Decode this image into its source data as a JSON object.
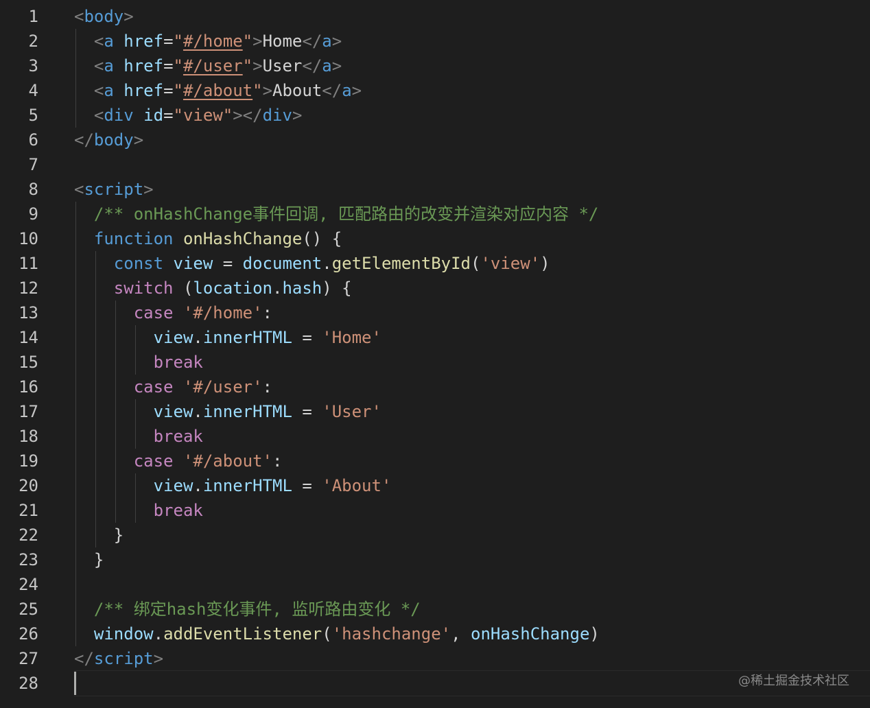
{
  "editor": {
    "lines": [
      {
        "n": "1",
        "tokens": [
          [
            "punc",
            "<"
          ],
          [
            "tag",
            "body"
          ],
          [
            "punc",
            ">"
          ]
        ]
      },
      {
        "n": "2",
        "tokens": [
          [
            "def",
            "  "
          ],
          [
            "punc",
            "<"
          ],
          [
            "tag",
            "a"
          ],
          [
            "def",
            " "
          ],
          [
            "attr",
            "href"
          ],
          [
            "op",
            "="
          ],
          [
            "str",
            "\""
          ],
          [
            "link",
            "#/home"
          ],
          [
            "str",
            "\""
          ],
          [
            "punc",
            ">"
          ],
          [
            "text",
            "Home"
          ],
          [
            "punc",
            "</"
          ],
          [
            "tag",
            "a"
          ],
          [
            "punc",
            ">"
          ]
        ]
      },
      {
        "n": "3",
        "tokens": [
          [
            "def",
            "  "
          ],
          [
            "punc",
            "<"
          ],
          [
            "tag",
            "a"
          ],
          [
            "def",
            " "
          ],
          [
            "attr",
            "href"
          ],
          [
            "op",
            "="
          ],
          [
            "str",
            "\""
          ],
          [
            "link",
            "#/user"
          ],
          [
            "str",
            "\""
          ],
          [
            "punc",
            ">"
          ],
          [
            "text",
            "User"
          ],
          [
            "punc",
            "</"
          ],
          [
            "tag",
            "a"
          ],
          [
            "punc",
            ">"
          ]
        ]
      },
      {
        "n": "4",
        "tokens": [
          [
            "def",
            "  "
          ],
          [
            "punc",
            "<"
          ],
          [
            "tag",
            "a"
          ],
          [
            "def",
            " "
          ],
          [
            "attr",
            "href"
          ],
          [
            "op",
            "="
          ],
          [
            "str",
            "\""
          ],
          [
            "link",
            "#/about"
          ],
          [
            "str",
            "\""
          ],
          [
            "punc",
            ">"
          ],
          [
            "text",
            "About"
          ],
          [
            "punc",
            "</"
          ],
          [
            "tag",
            "a"
          ],
          [
            "punc",
            ">"
          ]
        ]
      },
      {
        "n": "5",
        "tokens": [
          [
            "def",
            "  "
          ],
          [
            "punc",
            "<"
          ],
          [
            "tag",
            "div"
          ],
          [
            "def",
            " "
          ],
          [
            "attr",
            "id"
          ],
          [
            "op",
            "="
          ],
          [
            "str",
            "\"view\""
          ],
          [
            "punc",
            "></"
          ],
          [
            "tag",
            "div"
          ],
          [
            "punc",
            ">"
          ]
        ]
      },
      {
        "n": "6",
        "tokens": [
          [
            "punc",
            "</"
          ],
          [
            "tag",
            "body"
          ],
          [
            "punc",
            ">"
          ]
        ]
      },
      {
        "n": "7",
        "tokens": []
      },
      {
        "n": "8",
        "tokens": [
          [
            "punc",
            "<"
          ],
          [
            "tag",
            "script"
          ],
          [
            "punc",
            ">"
          ]
        ]
      },
      {
        "n": "9",
        "tokens": [
          [
            "def",
            "  "
          ],
          [
            "comment",
            "/** onHashChange事件回调, 匹配路由的改变并渲染对应内容 */"
          ]
        ]
      },
      {
        "n": "10",
        "tokens": [
          [
            "def",
            "  "
          ],
          [
            "kw",
            "function"
          ],
          [
            "def",
            " "
          ],
          [
            "fn",
            "onHashChange"
          ],
          [
            "def",
            "() {"
          ]
        ]
      },
      {
        "n": "11",
        "tokens": [
          [
            "def",
            "    "
          ],
          [
            "kw",
            "const"
          ],
          [
            "def",
            " "
          ],
          [
            "var",
            "view"
          ],
          [
            "def",
            " = "
          ],
          [
            "var",
            "document"
          ],
          [
            "def",
            "."
          ],
          [
            "fn",
            "getElementById"
          ],
          [
            "def",
            "("
          ],
          [
            "str",
            "'view'"
          ],
          [
            "def",
            ")"
          ]
        ]
      },
      {
        "n": "12",
        "tokens": [
          [
            "def",
            "    "
          ],
          [
            "ctrl",
            "switch"
          ],
          [
            "def",
            " ("
          ],
          [
            "var",
            "location"
          ],
          [
            "def",
            "."
          ],
          [
            "var",
            "hash"
          ],
          [
            "def",
            ") {"
          ]
        ]
      },
      {
        "n": "13",
        "tokens": [
          [
            "def",
            "      "
          ],
          [
            "ctrl",
            "case"
          ],
          [
            "def",
            " "
          ],
          [
            "str",
            "'#/home'"
          ],
          [
            "def",
            ":"
          ]
        ]
      },
      {
        "n": "14",
        "tokens": [
          [
            "def",
            "        "
          ],
          [
            "var",
            "view"
          ],
          [
            "def",
            "."
          ],
          [
            "var",
            "innerHTML"
          ],
          [
            "def",
            " = "
          ],
          [
            "str",
            "'Home'"
          ]
        ]
      },
      {
        "n": "15",
        "tokens": [
          [
            "def",
            "        "
          ],
          [
            "ctrl",
            "break"
          ]
        ]
      },
      {
        "n": "16",
        "tokens": [
          [
            "def",
            "      "
          ],
          [
            "ctrl",
            "case"
          ],
          [
            "def",
            " "
          ],
          [
            "str",
            "'#/user'"
          ],
          [
            "def",
            ":"
          ]
        ]
      },
      {
        "n": "17",
        "tokens": [
          [
            "def",
            "        "
          ],
          [
            "var",
            "view"
          ],
          [
            "def",
            "."
          ],
          [
            "var",
            "innerHTML"
          ],
          [
            "def",
            " = "
          ],
          [
            "str",
            "'User'"
          ]
        ]
      },
      {
        "n": "18",
        "tokens": [
          [
            "def",
            "        "
          ],
          [
            "ctrl",
            "break"
          ]
        ]
      },
      {
        "n": "19",
        "tokens": [
          [
            "def",
            "      "
          ],
          [
            "ctrl",
            "case"
          ],
          [
            "def",
            " "
          ],
          [
            "str",
            "'#/about'"
          ],
          [
            "def",
            ":"
          ]
        ]
      },
      {
        "n": "20",
        "tokens": [
          [
            "def",
            "        "
          ],
          [
            "var",
            "view"
          ],
          [
            "def",
            "."
          ],
          [
            "var",
            "innerHTML"
          ],
          [
            "def",
            " = "
          ],
          [
            "str",
            "'About'"
          ]
        ]
      },
      {
        "n": "21",
        "tokens": [
          [
            "def",
            "        "
          ],
          [
            "ctrl",
            "break"
          ]
        ]
      },
      {
        "n": "22",
        "tokens": [
          [
            "def",
            "    }"
          ]
        ]
      },
      {
        "n": "23",
        "tokens": [
          [
            "def",
            "  }"
          ]
        ]
      },
      {
        "n": "24",
        "tokens": []
      },
      {
        "n": "25",
        "tokens": [
          [
            "def",
            "  "
          ],
          [
            "comment",
            "/** 绑定hash变化事件, 监听路由变化 */"
          ]
        ]
      },
      {
        "n": "26",
        "tokens": [
          [
            "def",
            "  "
          ],
          [
            "var",
            "window"
          ],
          [
            "def",
            "."
          ],
          [
            "fn",
            "addEventListener"
          ],
          [
            "def",
            "("
          ],
          [
            "str",
            "'hashchange'"
          ],
          [
            "def",
            ", "
          ],
          [
            "var",
            "onHashChange"
          ],
          [
            "def",
            ")"
          ]
        ]
      },
      {
        "n": "27",
        "tokens": [
          [
            "punc",
            "</"
          ],
          [
            "tag",
            "script"
          ],
          [
            "punc",
            ">"
          ]
        ]
      },
      {
        "n": "28",
        "tokens": []
      }
    ]
  },
  "watermark": "@稀土掘金技术社区",
  "colors": {
    "background": "#1e1e1e",
    "tag": "#569cd6",
    "attribute": "#9cdcfe",
    "string": "#ce9178",
    "comment": "#6a9955",
    "function": "#dcdcaa",
    "control": "#c586c0"
  }
}
